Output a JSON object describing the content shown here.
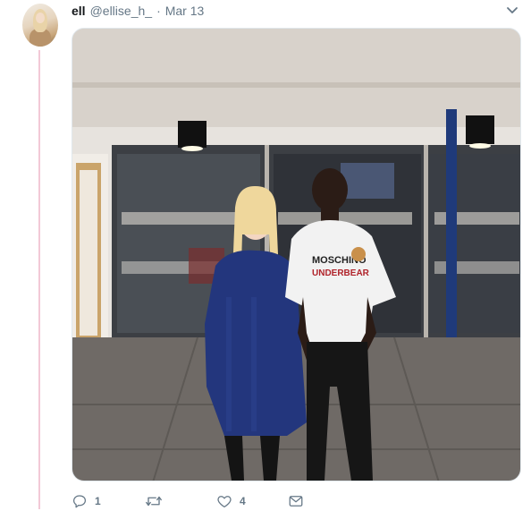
{
  "tweet": {
    "display_name": "ell",
    "handle": "@ellise_h_",
    "separator": "·",
    "date": "Mar 13",
    "avatar_icon": "user-avatar-photo",
    "menu_icon": "chevron-down-icon",
    "media_description_icon": "photo",
    "shirt_text_line1": "MOSCHINO",
    "shirt_text_line2": "UNDERBEAR",
    "actions": {
      "reply_count": "1",
      "retweet_count": "",
      "like_count": "4",
      "reply_icon": "reply-icon",
      "retweet_icon": "retweet-icon",
      "like_icon": "heart-icon",
      "dm_icon": "envelope-icon"
    }
  },
  "colors": {
    "thread_line": "#f2c9d6",
    "secondary_text": "#657786",
    "primary_text": "#14171a"
  }
}
